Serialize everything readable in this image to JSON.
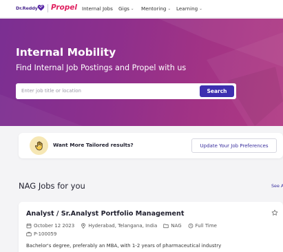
{
  "nav": {
    "brand_drr": "Dr.Reddy's",
    "brand_propel": "Propel",
    "items": [
      {
        "label": "Internal Jobs",
        "dropdown": false
      },
      {
        "label": "Gigs",
        "dropdown": true
      },
      {
        "label": "Mentoring",
        "dropdown": true
      },
      {
        "label": "Learning",
        "dropdown": true
      }
    ]
  },
  "hero": {
    "title": "Internal Mobility",
    "subtitle": "Find Internal Job Postings and Propel with us",
    "search_placeholder": "Enter job title or location",
    "search_button": "Search"
  },
  "tailored": {
    "text": "Want More Tailored results?",
    "button": "Update Your Job Preferences"
  },
  "section": {
    "title": "NAG Jobs for you",
    "see_all": "See A"
  },
  "job": {
    "title": "Analyst / Sr.Analyst Portfolio Management",
    "date": "October 12 2023",
    "location": "Hyderabad, Telangana, India",
    "department": "NAG",
    "type": "Full Time",
    "id": "P-100059",
    "description": "Bachelor's degree, preferably an MBA, with 1-2 years of pharmaceutical industry"
  },
  "colors": {
    "brand_purple": "#3d2fb0",
    "hero_start": "#7b2f92",
    "hero_end": "#b03a84",
    "propel_pink": "#e0205f"
  },
  "icons": {
    "brand": "heart-logo-icon",
    "tailored": "hand-wave-icon",
    "favorite": "star-icon",
    "date": "calendar-icon",
    "location": "location-pin-icon",
    "department": "folder-icon",
    "type": "clock-icon",
    "id": "briefcase-icon"
  }
}
